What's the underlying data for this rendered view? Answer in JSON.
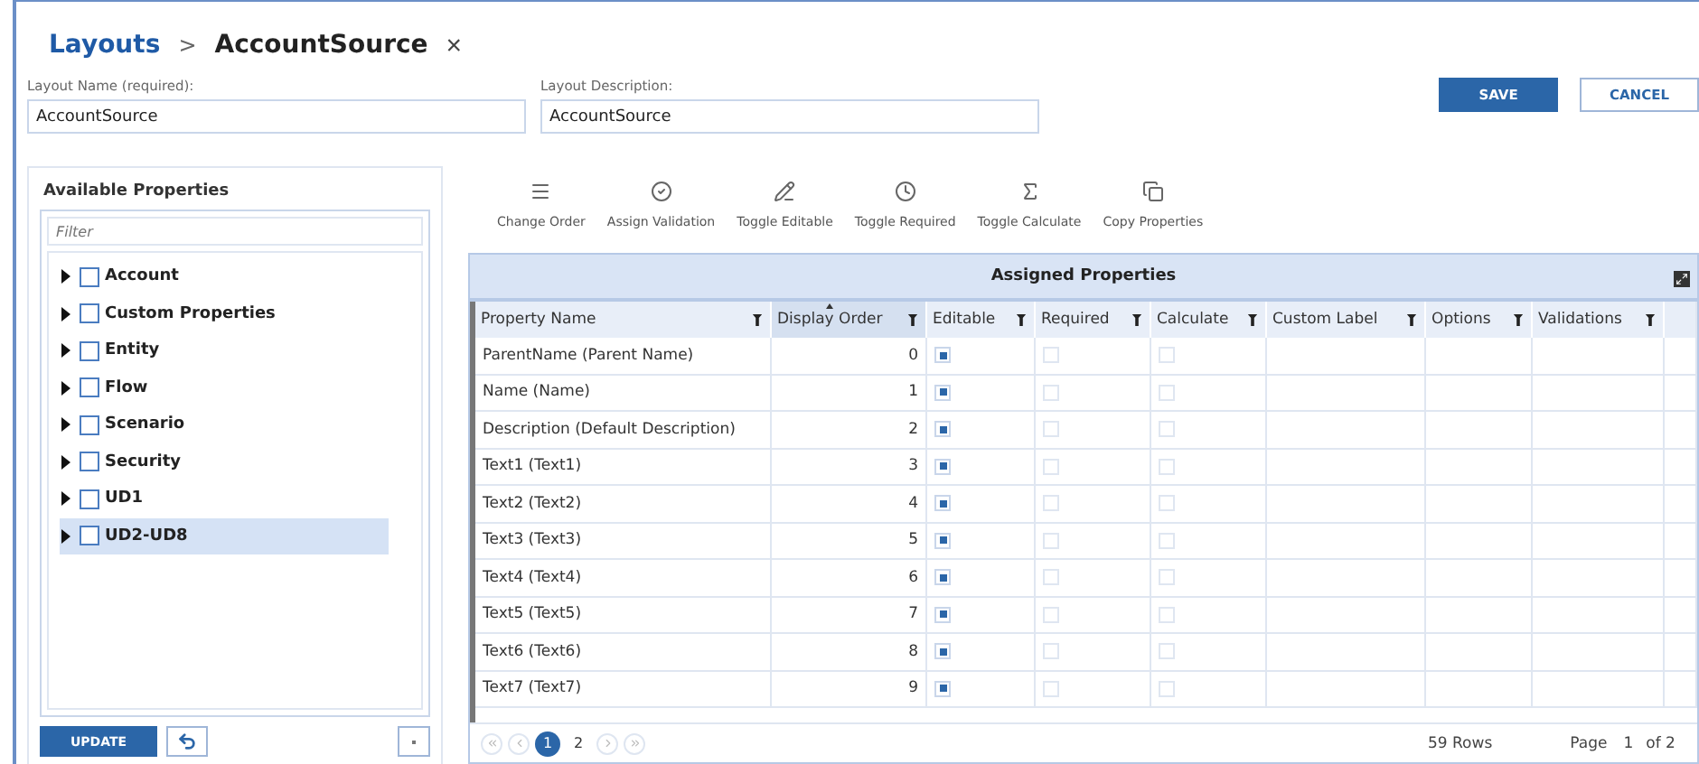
{
  "breadcrumb": {
    "parent": "Layouts",
    "separator": ">",
    "current": "AccountSource",
    "close": "×"
  },
  "fields": [
    {
      "label": "Layout Name (required):",
      "value": "AccountSource"
    },
    {
      "label": "Layout Description:",
      "value": "AccountSource"
    }
  ],
  "actions": [
    {
      "label": "SAVE",
      "kind": "primary"
    },
    {
      "label": "CANCEL",
      "kind": "secondary"
    }
  ],
  "available_properties": {
    "title": "Available Properties",
    "filter_placeholder": "Filter",
    "items": [
      {
        "label": "Account",
        "checked": false,
        "expanded": false,
        "selected": false
      },
      {
        "label": "Custom Properties",
        "checked": false,
        "expanded": false,
        "selected": false
      },
      {
        "label": "Entity",
        "checked": false,
        "expanded": false,
        "selected": false
      },
      {
        "label": "Flow",
        "checked": false,
        "expanded": false,
        "selected": false
      },
      {
        "label": "Scenario",
        "checked": false,
        "expanded": false,
        "selected": false
      },
      {
        "label": "Security",
        "checked": false,
        "expanded": false,
        "selected": false
      },
      {
        "label": "UD1",
        "checked": false,
        "expanded": false,
        "selected": false
      },
      {
        "label": "UD2-UD8",
        "checked": false,
        "expanded": false,
        "selected": true
      }
    ],
    "update_button": "UPDATE"
  },
  "toolbar": [
    {
      "label": "Change Order"
    },
    {
      "label": "Assign Validation"
    },
    {
      "label": "Toggle Editable"
    },
    {
      "label": "Toggle Required"
    },
    {
      "label": "Toggle Calculate"
    },
    {
      "label": "Copy Properties"
    }
  ],
  "grid": {
    "title": "Assigned Properties",
    "columns": [
      {
        "label": "Property Name",
        "sorted": false
      },
      {
        "label": "Display Order",
        "sorted": true
      },
      {
        "label": "Editable",
        "sorted": false
      },
      {
        "label": "Required",
        "sorted": false
      },
      {
        "label": "Calculate",
        "sorted": false
      },
      {
        "label": "Custom Label",
        "sorted": false
      },
      {
        "label": "Options",
        "sorted": false
      },
      {
        "label": "Validations",
        "sorted": false
      }
    ],
    "rows": [
      {
        "name": "ParentName (Parent Name)",
        "order": "0",
        "editable": true,
        "required": false,
        "calculate": false
      },
      {
        "name": "Name (Name)",
        "order": "1",
        "editable": true,
        "required": false,
        "calculate": false
      },
      {
        "name": "Description (Default Description)",
        "order": "2",
        "editable": true,
        "required": false,
        "calculate": false
      },
      {
        "name": "Text1 (Text1)",
        "order": "3",
        "editable": true,
        "required": false,
        "calculate": false
      },
      {
        "name": "Text2 (Text2)",
        "order": "4",
        "editable": true,
        "required": false,
        "calculate": false
      },
      {
        "name": "Text3 (Text3)",
        "order": "5",
        "editable": true,
        "required": false,
        "calculate": false
      },
      {
        "name": "Text4 (Text4)",
        "order": "6",
        "editable": true,
        "required": false,
        "calculate": false
      },
      {
        "name": "Text5 (Text5)",
        "order": "7",
        "editable": true,
        "required": false,
        "calculate": false
      },
      {
        "name": "Text6 (Text6)",
        "order": "8",
        "editable": true,
        "required": false,
        "calculate": false
      },
      {
        "name": "Text7 (Text7)",
        "order": "9",
        "editable": true,
        "required": false,
        "calculate": false
      }
    ],
    "pager": {
      "pages": [
        {
          "label": "1",
          "selected": true
        },
        {
          "label": "2",
          "selected": false
        }
      ],
      "row_count": "59 Rows",
      "page_label": "Page",
      "page_number": "1",
      "page_total": "of 2"
    }
  }
}
